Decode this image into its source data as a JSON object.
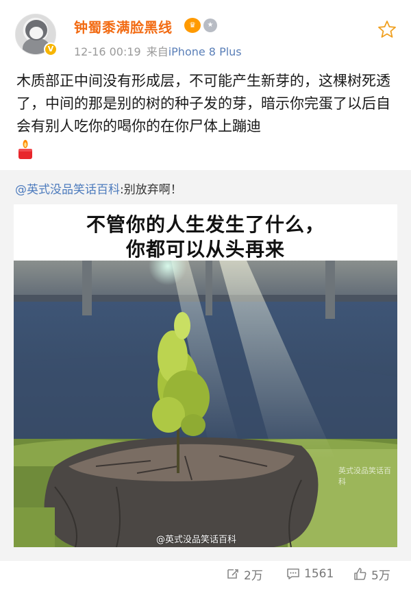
{
  "post": {
    "username": "钟蜀黍满脸黑线",
    "time": "12-16 00:19",
    "from_label": "来自",
    "device": "iPhone 8 Plus",
    "text": "木质部正中间没有形成层，不可能产生新芽的，这棵树死透了，中间的那是别的树的种子发的芽，暗示你完蛋了以后自会有别人吃你的喝你的在你尸体上蹦迪"
  },
  "repost": {
    "mention": "@英式没品笑话百科",
    "text": ":别放弃啊！",
    "image": {
      "caption_line1": "不管你的人生发生了什么，",
      "caption_line2": "你都可以从头再来",
      "watermark": "@英式没品笑话百科",
      "watermark_corner": "英式没品笑话百科"
    }
  },
  "actions": {
    "reposts": "2万",
    "comments": "1561",
    "likes": "5万"
  },
  "colors": {
    "username": "#f26b13",
    "link": "#4d7bbd",
    "meta": "#9a9a9a",
    "repost_bg": "#f3f3f3"
  },
  "icons": [
    "crown-badge-icon",
    "medal-badge-icon",
    "star-icon",
    "candle-emoji-icon",
    "repost-icon",
    "comment-icon",
    "like-icon"
  ]
}
